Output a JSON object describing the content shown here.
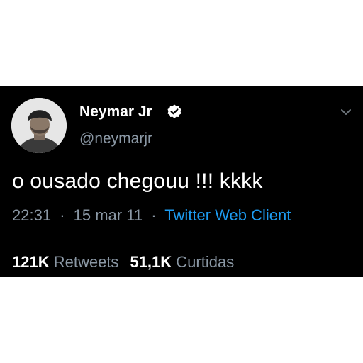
{
  "tweet": {
    "author": {
      "name": "Neymar Jr",
      "handle": "@neymarjr",
      "verified_icon": "verified-badge-icon"
    },
    "text": "o ousado chegouu !!! kkkk",
    "time": "22:31",
    "date": "15 mar 11",
    "separator": "·",
    "client": "Twitter Web Client",
    "stats": {
      "retweets_count": "121K",
      "retweets_label": "Retweets",
      "likes_count": "51,1K",
      "likes_label": "Curtidas"
    },
    "menu_icon": "chevron-down-icon"
  },
  "colors": {
    "background": "#000000",
    "primary_text": "#ffffff",
    "secondary_text": "#8b98a5",
    "link": "#1d9bf0",
    "divider": "#2f3336"
  }
}
